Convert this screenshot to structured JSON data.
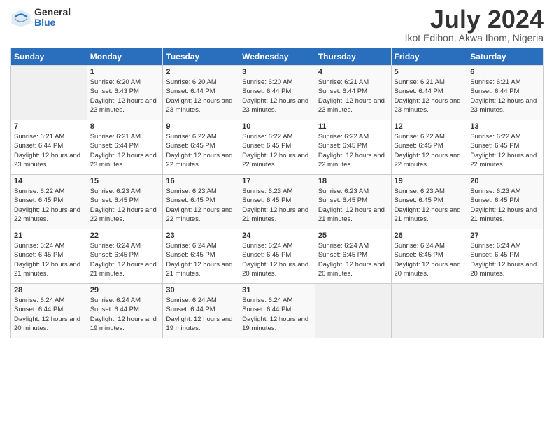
{
  "header": {
    "logo_general": "General",
    "logo_blue": "Blue",
    "month_title": "July 2024",
    "subtitle": "Ikot Edibon, Akwa Ibom, Nigeria"
  },
  "weekdays": [
    "Sunday",
    "Monday",
    "Tuesday",
    "Wednesday",
    "Thursday",
    "Friday",
    "Saturday"
  ],
  "weeks": [
    [
      {
        "day": "",
        "sunrise": "",
        "sunset": "",
        "daylight": ""
      },
      {
        "day": "1",
        "sunrise": "Sunrise: 6:20 AM",
        "sunset": "Sunset: 6:43 PM",
        "daylight": "Daylight: 12 hours and 23 minutes."
      },
      {
        "day": "2",
        "sunrise": "Sunrise: 6:20 AM",
        "sunset": "Sunset: 6:44 PM",
        "daylight": "Daylight: 12 hours and 23 minutes."
      },
      {
        "day": "3",
        "sunrise": "Sunrise: 6:20 AM",
        "sunset": "Sunset: 6:44 PM",
        "daylight": "Daylight: 12 hours and 23 minutes."
      },
      {
        "day": "4",
        "sunrise": "Sunrise: 6:21 AM",
        "sunset": "Sunset: 6:44 PM",
        "daylight": "Daylight: 12 hours and 23 minutes."
      },
      {
        "day": "5",
        "sunrise": "Sunrise: 6:21 AM",
        "sunset": "Sunset: 6:44 PM",
        "daylight": "Daylight: 12 hours and 23 minutes."
      },
      {
        "day": "6",
        "sunrise": "Sunrise: 6:21 AM",
        "sunset": "Sunset: 6:44 PM",
        "daylight": "Daylight: 12 hours and 23 minutes."
      }
    ],
    [
      {
        "day": "7",
        "sunrise": "Sunrise: 6:21 AM",
        "sunset": "Sunset: 6:44 PM",
        "daylight": "Daylight: 12 hours and 23 minutes."
      },
      {
        "day": "8",
        "sunrise": "Sunrise: 6:21 AM",
        "sunset": "Sunset: 6:44 PM",
        "daylight": "Daylight: 12 hours and 23 minutes."
      },
      {
        "day": "9",
        "sunrise": "Sunrise: 6:22 AM",
        "sunset": "Sunset: 6:45 PM",
        "daylight": "Daylight: 12 hours and 22 minutes."
      },
      {
        "day": "10",
        "sunrise": "Sunrise: 6:22 AM",
        "sunset": "Sunset: 6:45 PM",
        "daylight": "Daylight: 12 hours and 22 minutes."
      },
      {
        "day": "11",
        "sunrise": "Sunrise: 6:22 AM",
        "sunset": "Sunset: 6:45 PM",
        "daylight": "Daylight: 12 hours and 22 minutes."
      },
      {
        "day": "12",
        "sunrise": "Sunrise: 6:22 AM",
        "sunset": "Sunset: 6:45 PM",
        "daylight": "Daylight: 12 hours and 22 minutes."
      },
      {
        "day": "13",
        "sunrise": "Sunrise: 6:22 AM",
        "sunset": "Sunset: 6:45 PM",
        "daylight": "Daylight: 12 hours and 22 minutes."
      }
    ],
    [
      {
        "day": "14",
        "sunrise": "Sunrise: 6:22 AM",
        "sunset": "Sunset: 6:45 PM",
        "daylight": "Daylight: 12 hours and 22 minutes."
      },
      {
        "day": "15",
        "sunrise": "Sunrise: 6:23 AM",
        "sunset": "Sunset: 6:45 PM",
        "daylight": "Daylight: 12 hours and 22 minutes."
      },
      {
        "day": "16",
        "sunrise": "Sunrise: 6:23 AM",
        "sunset": "Sunset: 6:45 PM",
        "daylight": "Daylight: 12 hours and 22 minutes."
      },
      {
        "day": "17",
        "sunrise": "Sunrise: 6:23 AM",
        "sunset": "Sunset: 6:45 PM",
        "daylight": "Daylight: 12 hours and 21 minutes."
      },
      {
        "day": "18",
        "sunrise": "Sunrise: 6:23 AM",
        "sunset": "Sunset: 6:45 PM",
        "daylight": "Daylight: 12 hours and 21 minutes."
      },
      {
        "day": "19",
        "sunrise": "Sunrise: 6:23 AM",
        "sunset": "Sunset: 6:45 PM",
        "daylight": "Daylight: 12 hours and 21 minutes."
      },
      {
        "day": "20",
        "sunrise": "Sunrise: 6:23 AM",
        "sunset": "Sunset: 6:45 PM",
        "daylight": "Daylight: 12 hours and 21 minutes."
      }
    ],
    [
      {
        "day": "21",
        "sunrise": "Sunrise: 6:24 AM",
        "sunset": "Sunset: 6:45 PM",
        "daylight": "Daylight: 12 hours and 21 minutes."
      },
      {
        "day": "22",
        "sunrise": "Sunrise: 6:24 AM",
        "sunset": "Sunset: 6:45 PM",
        "daylight": "Daylight: 12 hours and 21 minutes."
      },
      {
        "day": "23",
        "sunrise": "Sunrise: 6:24 AM",
        "sunset": "Sunset: 6:45 PM",
        "daylight": "Daylight: 12 hours and 21 minutes."
      },
      {
        "day": "24",
        "sunrise": "Sunrise: 6:24 AM",
        "sunset": "Sunset: 6:45 PM",
        "daylight": "Daylight: 12 hours and 20 minutes."
      },
      {
        "day": "25",
        "sunrise": "Sunrise: 6:24 AM",
        "sunset": "Sunset: 6:45 PM",
        "daylight": "Daylight: 12 hours and 20 minutes."
      },
      {
        "day": "26",
        "sunrise": "Sunrise: 6:24 AM",
        "sunset": "Sunset: 6:45 PM",
        "daylight": "Daylight: 12 hours and 20 minutes."
      },
      {
        "day": "27",
        "sunrise": "Sunrise: 6:24 AM",
        "sunset": "Sunset: 6:45 PM",
        "daylight": "Daylight: 12 hours and 20 minutes."
      }
    ],
    [
      {
        "day": "28",
        "sunrise": "Sunrise: 6:24 AM",
        "sunset": "Sunset: 6:44 PM",
        "daylight": "Daylight: 12 hours and 20 minutes."
      },
      {
        "day": "29",
        "sunrise": "Sunrise: 6:24 AM",
        "sunset": "Sunset: 6:44 PM",
        "daylight": "Daylight: 12 hours and 19 minutes."
      },
      {
        "day": "30",
        "sunrise": "Sunrise: 6:24 AM",
        "sunset": "Sunset: 6:44 PM",
        "daylight": "Daylight: 12 hours and 19 minutes."
      },
      {
        "day": "31",
        "sunrise": "Sunrise: 6:24 AM",
        "sunset": "Sunset: 6:44 PM",
        "daylight": "Daylight: 12 hours and 19 minutes."
      },
      {
        "day": "",
        "sunrise": "",
        "sunset": "",
        "daylight": ""
      },
      {
        "day": "",
        "sunrise": "",
        "sunset": "",
        "daylight": ""
      },
      {
        "day": "",
        "sunrise": "",
        "sunset": "",
        "daylight": ""
      }
    ]
  ]
}
